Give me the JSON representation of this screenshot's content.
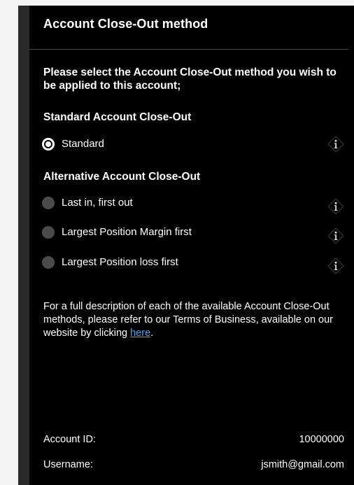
{
  "dialog": {
    "title": "Account Close-Out method",
    "prompt": "Please select the Account Close-Out method you wish to be applied to this account;"
  },
  "standard_section": {
    "label": "Standard Account Close-Out",
    "options": [
      {
        "label": "Standard",
        "selected": true
      }
    ]
  },
  "alternative_section": {
    "label": "Alternative Account Close-Out",
    "options": [
      {
        "label": "Last in, first out",
        "selected": false
      },
      {
        "label": "Largest Position Margin first",
        "selected": false
      },
      {
        "label": "Largest Position loss first",
        "selected": false
      }
    ]
  },
  "description": {
    "text_before_link": "For a full description of each of the available Account Close-Out methods, please refer to our Terms of Business, available on our website by clicking ",
    "link_text": "here",
    "text_after_link": "."
  },
  "account": {
    "id_label": "Account ID:",
    "id_value": "10000000",
    "username_label": "Username:",
    "username_value": "jsmith@gmail.com"
  },
  "icons": {
    "info": "info-diamond-icon"
  },
  "colors": {
    "panel_background": "#000000",
    "link": "#3ea7ff",
    "radio_unselected": "#4b4b4d",
    "divider": "#4a4a4a"
  }
}
